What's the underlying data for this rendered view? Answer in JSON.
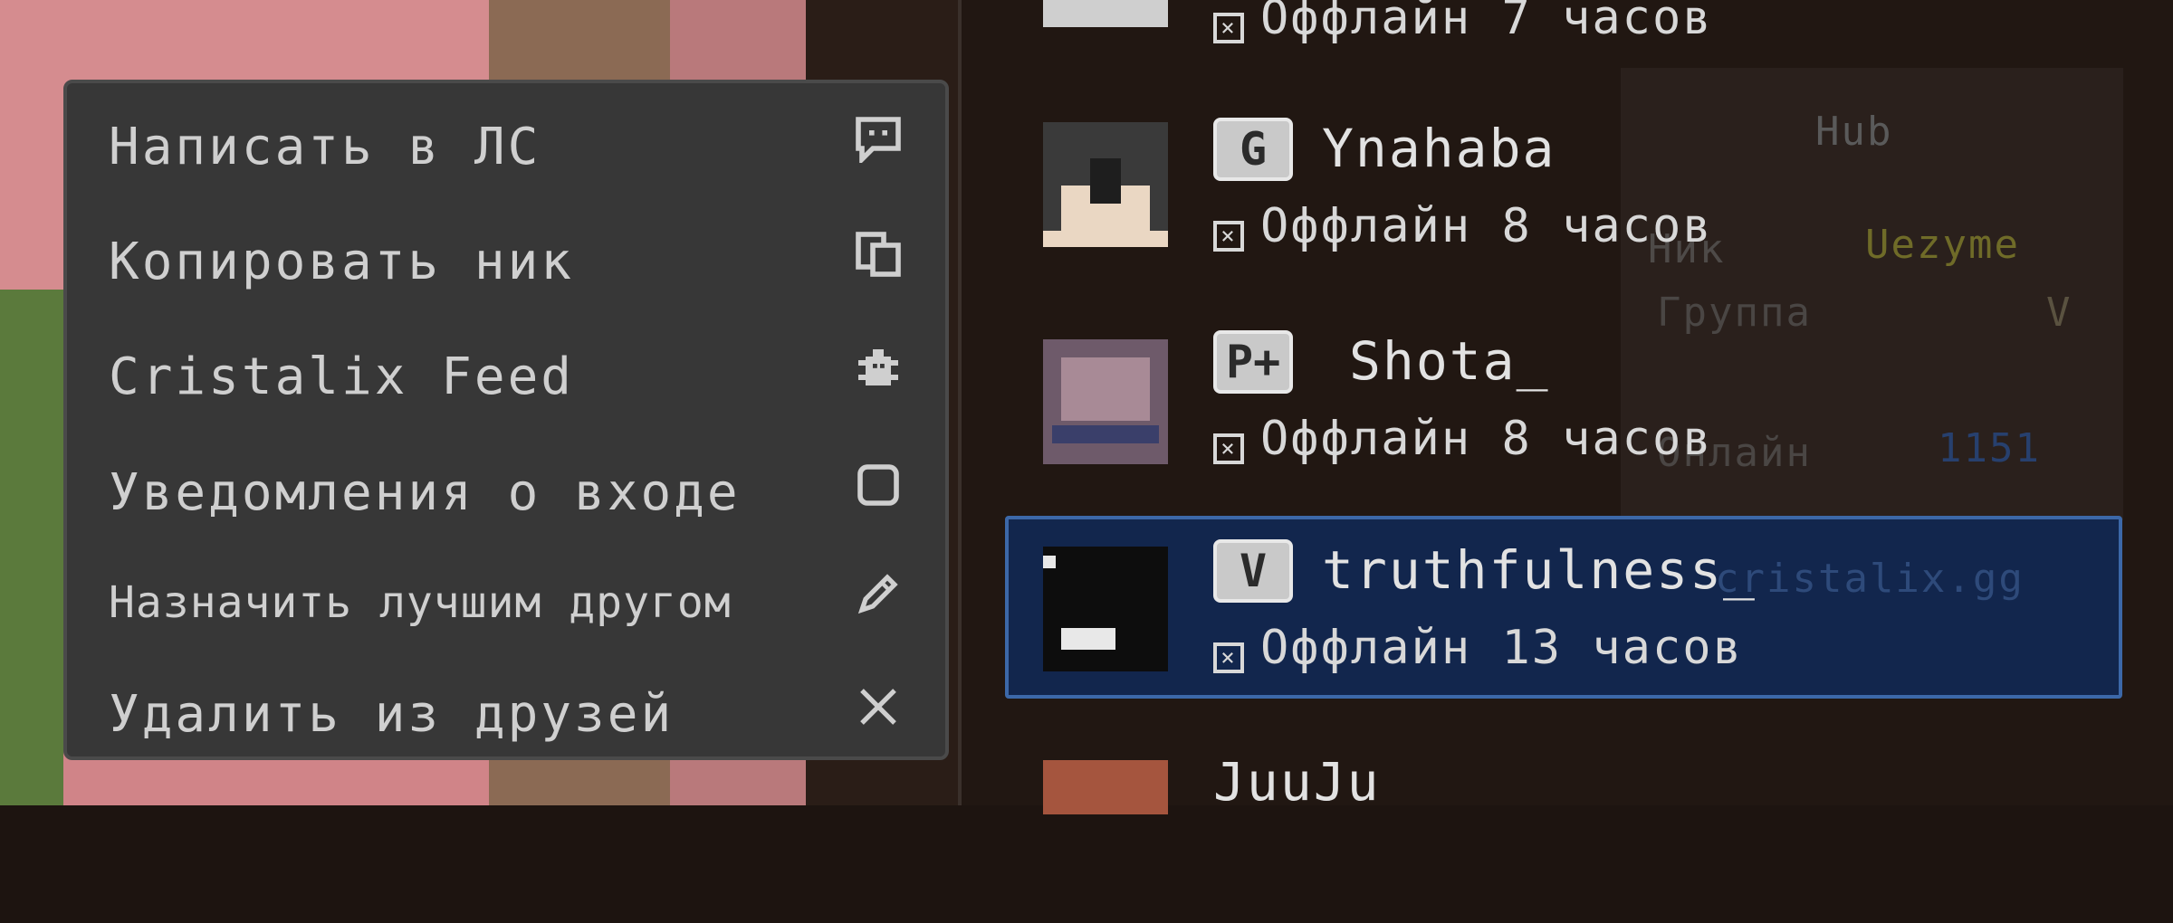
{
  "context_menu": {
    "items": [
      {
        "label": "Написать в ЛС",
        "icon": "chat-bubble-icon"
      },
      {
        "label": "Копировать ник",
        "icon": "copy-icon"
      },
      {
        "label": "Cristalix Feed",
        "icon": "bug-icon"
      },
      {
        "label": "Уведомления о входе",
        "icon": "checkbox-icon"
      },
      {
        "label": "Назначить лучшим другом",
        "icon": "pencil-icon"
      },
      {
        "label": "Удалить из друзей",
        "icon": "close-icon"
      }
    ]
  },
  "friends": [
    {
      "rank": "",
      "name": "",
      "status": "Оффлайн 7 часов"
    },
    {
      "rank": "G",
      "name": "Ynahaba",
      "status": "Оффлайн 8 часов"
    },
    {
      "rank": "P+",
      "name": "Shota_",
      "status": "Оффлайн 8 часов"
    },
    {
      "rank": "V",
      "name": "truthfulness_",
      "status": "Оффлайн 13 часов",
      "selected": true
    },
    {
      "rank": "",
      "name": "JuuJu",
      "status": ""
    }
  ],
  "info_card": {
    "server": "Hub",
    "nick_label": "Ник",
    "nick_value": "Uezyme",
    "group_label": "Группа",
    "group_value": "V",
    "online_label": "Онлайн",
    "online_value": "1151",
    "site": "cristalix.gg"
  },
  "colors": {
    "selection_bg": "#12264d",
    "selection_border": "#3c68a8",
    "menu_bg": "#373737",
    "nick_color": "#8a8a3a",
    "online_color": "#2d4e8a"
  }
}
